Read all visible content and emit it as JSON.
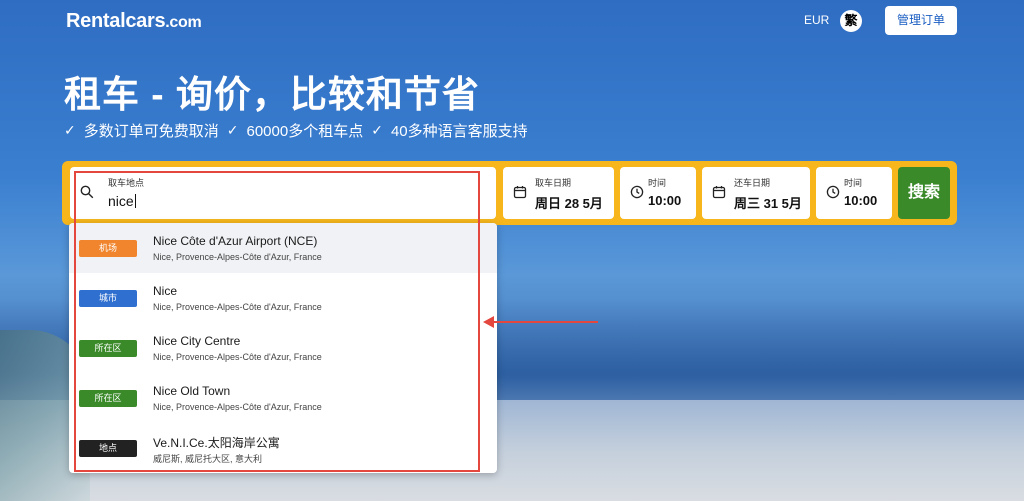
{
  "header": {
    "logo_main": "Rentalcars",
    "logo_suffix": ".com",
    "currency": "EUR",
    "language": "繁",
    "manage_booking": "管理订单"
  },
  "hero": {
    "title": "租车 - 询价，比较和节省",
    "features": [
      "多数订单可免费取消",
      "60000多个租车点",
      "40多种语言客服支持"
    ]
  },
  "search": {
    "pickup_label": "取车地点",
    "pickup_value": "nice",
    "pickup_date_label": "取车日期",
    "pickup_date_value": "周日 28 5月",
    "pickup_time_label": "时间",
    "pickup_time_value": "10:00",
    "dropoff_date_label": "还车日期",
    "dropoff_date_value": "周三 31 5月",
    "dropoff_time_label": "时间",
    "dropoff_time_value": "10:00",
    "search_button": "搜索"
  },
  "suggestions": [
    {
      "tag": "机场",
      "tag_color": "#f0852d",
      "title": "Nice Côte d'Azur Airport (NCE)",
      "subtitle": "Nice, Provence-Alpes-Côte d'Azur, France"
    },
    {
      "tag": "城市",
      "tag_color": "#2f6fcf",
      "title": "Nice",
      "subtitle": "Nice, Provence-Alpes-Côte d'Azur, France"
    },
    {
      "tag": "所在区",
      "tag_color": "#3a8a2a",
      "title": "Nice City Centre",
      "subtitle": "Nice, Provence-Alpes-Côte d'Azur, France"
    },
    {
      "tag": "所在区",
      "tag_color": "#3a8a2a",
      "title": "Nice Old Town",
      "subtitle": "Nice, Provence-Alpes-Côte d'Azur, France"
    },
    {
      "tag": "地点",
      "tag_color": "#222222",
      "title": "Ve.N.I.Ce.太阳海岸公寓",
      "subtitle": "威尼斯, 威尼托大区, 意大利"
    }
  ],
  "colors": {
    "accent_yellow": "#f6b61c",
    "search_green": "#3a8a2a",
    "annotation_red": "#e4473d"
  }
}
